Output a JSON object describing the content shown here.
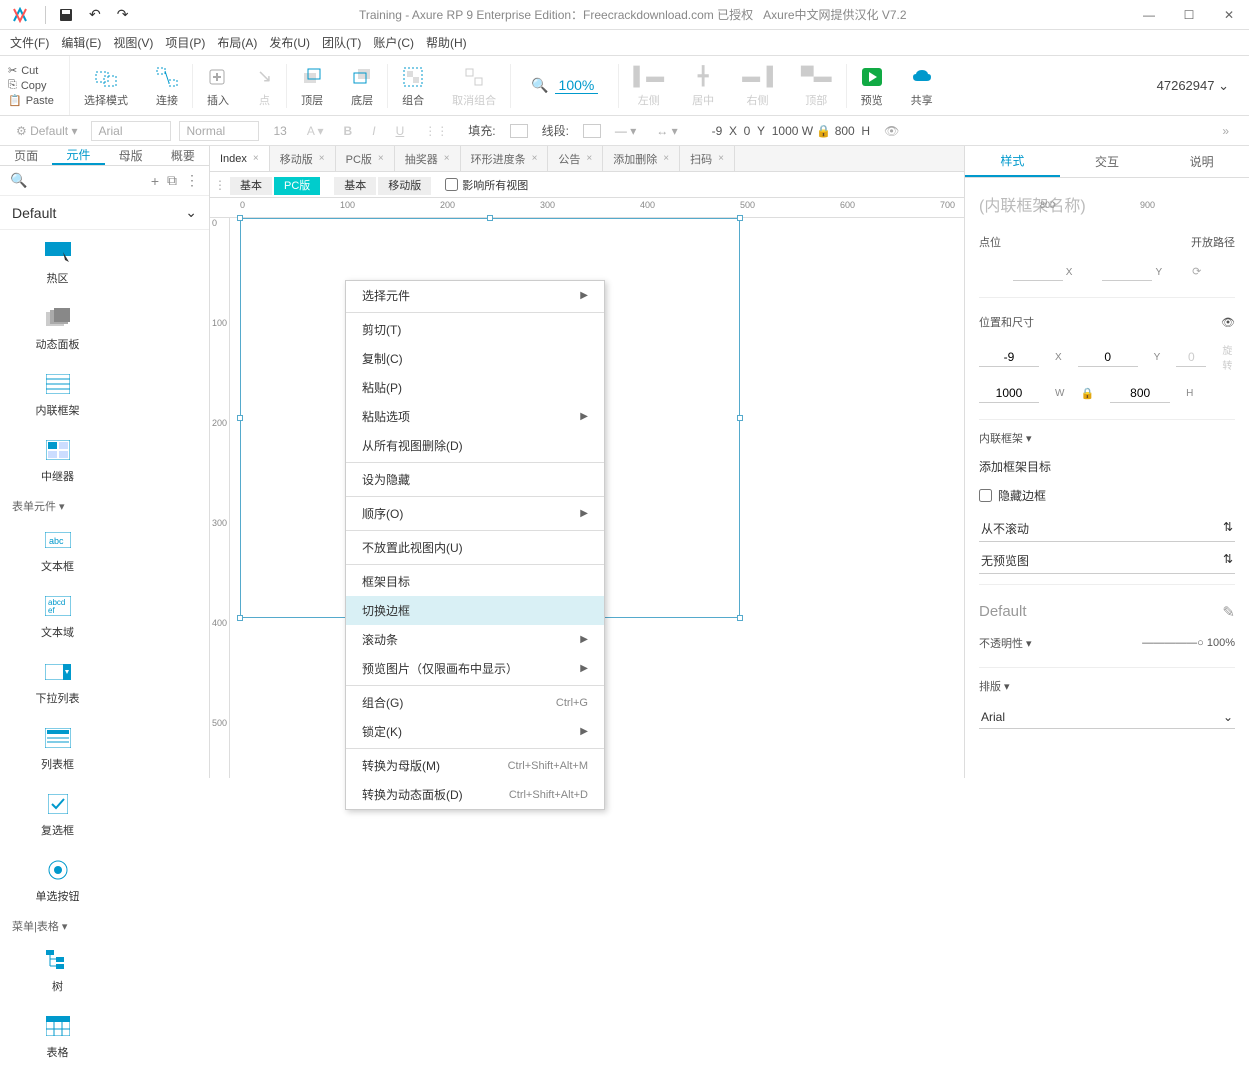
{
  "title": {
    "main": "Training - Axure RP 9 Enterprise Edition：Freecrackdownload.com 已授权",
    "suffix": "Axure中文网提供汉化 V7.2"
  },
  "menu": [
    "文件(F)",
    "编辑(E)",
    "视图(V)",
    "项目(P)",
    "布局(A)",
    "发布(U)",
    "团队(T)",
    "账户(C)",
    "帮助(H)"
  ],
  "clip": {
    "cut": "Cut",
    "copy": "Copy",
    "paste": "Paste"
  },
  "toolbar": {
    "select": "选择模式",
    "connect": "连接",
    "insert": "插入",
    "point": "点",
    "top": "顶层",
    "bottom": "底层",
    "group": "组合",
    "ungroup": "取消组合",
    "zoom": "100%",
    "left": "左侧",
    "center": "居中",
    "right": "右侧",
    "topAlign": "顶部",
    "preview": "预览",
    "share": "共享"
  },
  "user": "47262947",
  "stylebar": {
    "style": "Default",
    "font": "Arial",
    "weight": "Normal",
    "size": "13",
    "fill": "填充:",
    "stroke": "线段:",
    "x": "-9",
    "xl": "X",
    "y": "0",
    "yl": "Y",
    "w": "1000",
    "wl": "W",
    "h": "800",
    "hl": "H"
  },
  "leftTabs": [
    "页面",
    "元件",
    "母版",
    "概要"
  ],
  "leftTitle": "Default",
  "leftCats": {
    "form": "表单元件 ▾",
    "menu": "菜单|表格 ▾"
  },
  "widgets": {
    "hotspot": "热区",
    "panel": "动态面板",
    "iframe": "内联框架",
    "repeater": "中继器",
    "textfield": "文本框",
    "textarea": "文本域",
    "dropdown": "下拉列表",
    "listbox": "列表框",
    "checkbox": "复选框",
    "radio": "单选按钮",
    "tree": "树",
    "table": "表格"
  },
  "docTabs": [
    {
      "label": "Index",
      "active": true
    },
    {
      "label": "移动版"
    },
    {
      "label": "PC版"
    },
    {
      "label": "抽奖器"
    },
    {
      "label": "环形进度条"
    },
    {
      "label": "公告"
    },
    {
      "label": "添加删除"
    },
    {
      "label": "扫码"
    }
  ],
  "viewTabs": {
    "group1": [
      {
        "label": "基本"
      },
      {
        "label": "PC版",
        "active": true
      }
    ],
    "group2": [
      {
        "label": "基本"
      },
      {
        "label": "移动版"
      }
    ],
    "check": "影响所有视图"
  },
  "rulerH": [
    "0",
    "100",
    "200",
    "300",
    "400",
    "500",
    "600",
    "700",
    "800",
    "900"
  ],
  "rulerV": [
    "0",
    "100",
    "200",
    "300",
    "400",
    "500"
  ],
  "context": [
    {
      "label": "选择元件",
      "arrow": true
    },
    {
      "sep": true
    },
    {
      "label": "剪切(T)"
    },
    {
      "label": "复制(C)"
    },
    {
      "label": "粘贴(P)"
    },
    {
      "label": "粘贴选项",
      "arrow": true
    },
    {
      "label": "从所有视图删除(D)"
    },
    {
      "sep": true
    },
    {
      "label": "设为隐藏"
    },
    {
      "sep": true
    },
    {
      "label": "顺序(O)",
      "arrow": true
    },
    {
      "sep": true
    },
    {
      "label": "不放置此视图内(U)"
    },
    {
      "sep": true
    },
    {
      "label": "框架目标"
    },
    {
      "label": "切换边框",
      "hl": true
    },
    {
      "label": "滚动条",
      "arrow": true
    },
    {
      "label": "预览图片（仅限画布中显示）",
      "arrow": true
    },
    {
      "sep": true
    },
    {
      "label": "组合(G)",
      "short": "Ctrl+G"
    },
    {
      "label": "锁定(K)",
      "arrow": true
    },
    {
      "sep": true
    },
    {
      "label": "转换为母版(M)",
      "short": "Ctrl+Shift+Alt+M"
    },
    {
      "label": "转换为动态面板(D)",
      "short": "Ctrl+Shift+Alt+D"
    }
  ],
  "rightTabs": [
    "样式",
    "交互",
    "说明"
  ],
  "right": {
    "namePlaceholder": "(内联框架名称)",
    "pos": "点位",
    "openpath": "开放路径",
    "xl": "X",
    "yl": "Y",
    "sizepos": "位置和尺寸",
    "x": "-9",
    "y": "0",
    "w": "1000",
    "h": "800",
    "rot": "0",
    "rotl": "旋转",
    "wl": "W",
    "hl": "H",
    "iframe": "内联框架 ▾",
    "addTarget": "添加框架目标",
    "hideBorder": "隐藏边框",
    "scroll": "从不滚动",
    "preview": "无预览图",
    "defaultTitle": "Default",
    "opacity": "不透明性 ▾",
    "opacityVal": "100%",
    "layout": "排版 ▾",
    "fontSel": "Arial"
  }
}
